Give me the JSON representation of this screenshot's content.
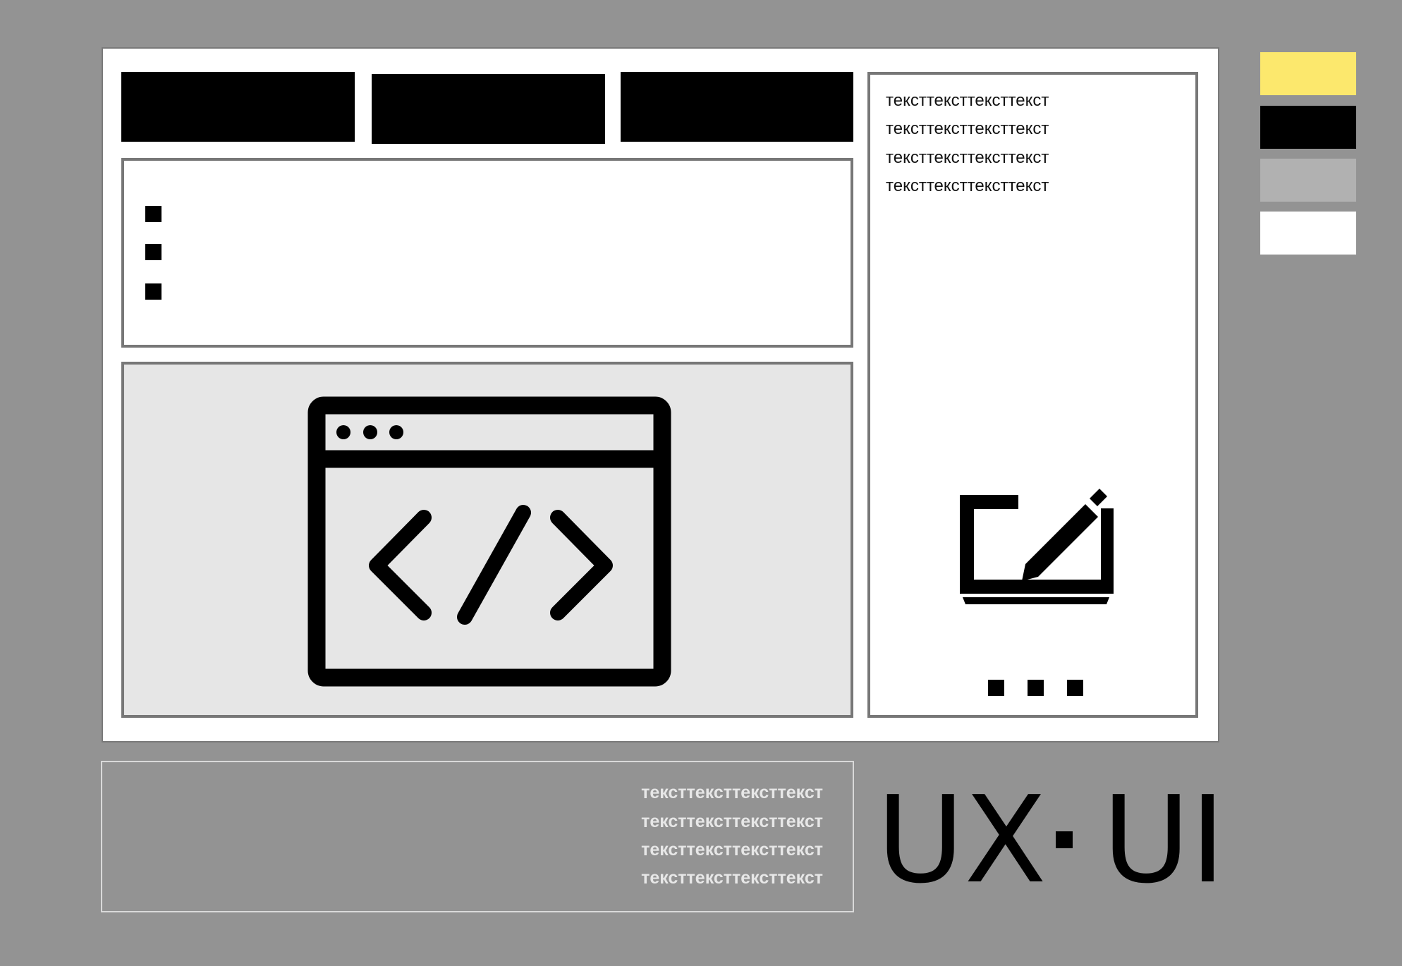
{
  "palette": {
    "background": "#939393",
    "frame": "#ffffff",
    "code_panel": "#e6e6e6",
    "swatches": [
      "#fce86d",
      "#000000",
      "#b1b1b1",
      "#ffffff"
    ]
  },
  "side_panel": {
    "text_lines": [
      "тексттексттексттекст",
      "тексттексттексттекст",
      "тексттексттексттекст",
      "тексттексттексттекст"
    ]
  },
  "bottom_box": {
    "text_lines": [
      "тексттексттексттекст",
      "тексттексттексттекст",
      "тексттексттексттекст",
      "тексттексттексттекст"
    ]
  },
  "brand": {
    "left": "UX",
    "separator": "·",
    "right": "UI"
  },
  "icons": {
    "main": "code-window-icon",
    "side": "tablet-pen-icon"
  }
}
